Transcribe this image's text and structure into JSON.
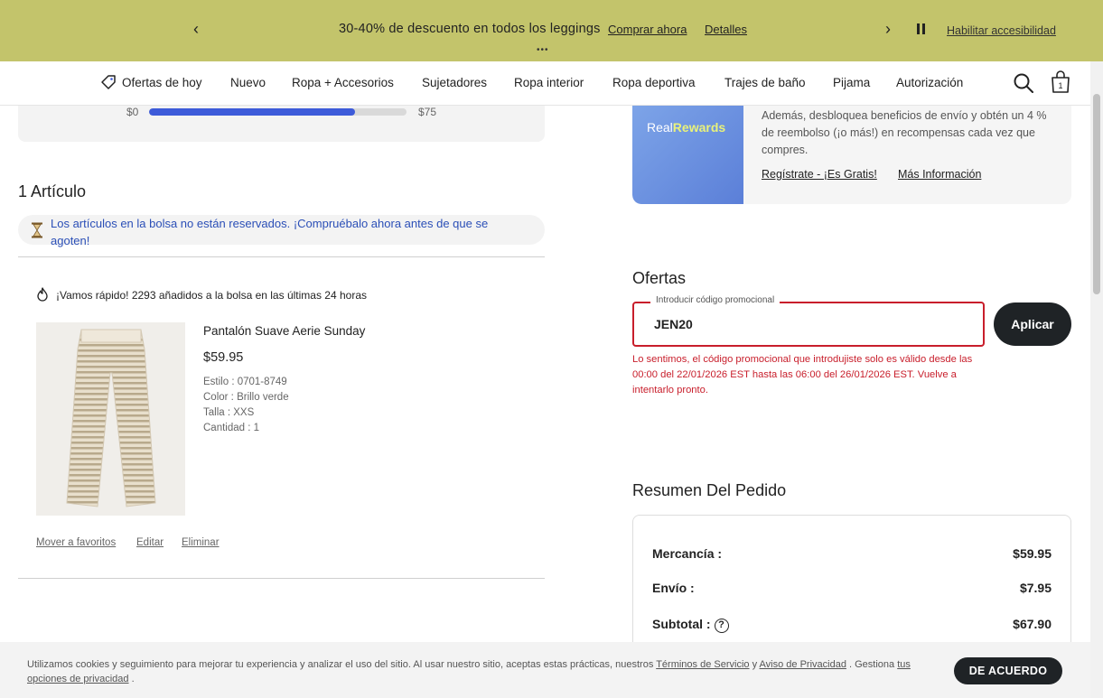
{
  "banner": {
    "message": "30-40% de descuento en todos los leggings",
    "shop_now": "Comprar ahora",
    "details": "Detalles",
    "dots": "•••",
    "accessibility": "Habilitar accesibilidad"
  },
  "nav": {
    "items": [
      "Ofertas de hoy",
      "Nuevo",
      "Ropa + Accesorios",
      "Sujetadores",
      "Ropa interior",
      "Ropa deportiva",
      "Trajes de baño",
      "Pijama",
      "Autorización"
    ],
    "bag_count": "1"
  },
  "shipping_progress": {
    "min_label": "$0",
    "max_label": "$75",
    "fraction": 0.8
  },
  "cart": {
    "title": "1 Artículo",
    "notice": "Los artículos en la bolsa no están reservados. ¡Compruébalo ahora antes de que se agoten!",
    "hot_message": "¡Vamos rápido! 2293 añadidos a la bolsa en las últimas 24 horas",
    "item": {
      "name": "Pantalón Suave Aerie Sunday",
      "price": "$59.95",
      "style": "Estilo : 0701-8749",
      "color": "Color : Brillo verde",
      "size": "Talla : XXS",
      "quantity": "Cantidad : 1"
    },
    "actions": {
      "favorite": "Mover a favoritos",
      "edit": "Editar",
      "remove": "Eliminar"
    }
  },
  "rewards": {
    "brand_prefix": "Real",
    "brand_suffix": "Rewards",
    "description": "Además, desbloquea beneficios de envío y obtén un 4 % de reembolso (¡o más!) en recompensas cada vez que compres.",
    "signup": "Regístrate - ¡Es Gratis!",
    "more_info": "Más Información"
  },
  "offers": {
    "title": "Ofertas",
    "field_label": "Introducir código promocional",
    "code": "JEN20",
    "apply": "Aplicar",
    "error": "Lo sentimos, el código promocional que introdujiste solo es válido desde las 00:00 del 22/01/2026 EST hasta las 06:00 del 26/01/2026 EST. Vuelve a intentarlo pronto."
  },
  "summary": {
    "title": "Resumen Del Pedido",
    "merchandise_label": "Mercancía :",
    "merchandise_value": "$59.95",
    "shipping_label": "Envío :",
    "shipping_value": "$7.95",
    "subtotal_label": "Subtotal :",
    "subtotal_value": "$67.90"
  },
  "cookie": {
    "text_before": "Utilizamos cookies y seguimiento para mejorar tu experiencia y analizar el uso del sitio. Al usar nuestro sitio, aceptas estas prácticas, nuestros",
    "terms": "Términos de Servicio",
    "and": "y",
    "privacy": "Aviso de Privacidad",
    "manage": ". Gestiona",
    "options": "tus opciones de privacidad",
    "end": ".",
    "agree": "DE ACUERDO"
  },
  "colors": {
    "banner_bg": "#c3c46b",
    "accent_blue": "#3d5bd9",
    "error_red": "#c81e2b",
    "button_dark": "#1f2326"
  }
}
